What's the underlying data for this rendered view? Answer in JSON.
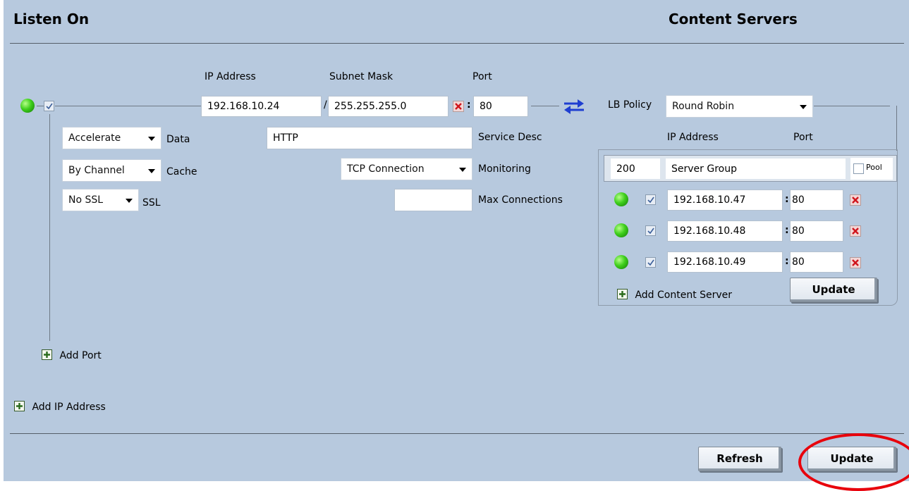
{
  "headers": {
    "listen_on": "Listen On",
    "content_servers": "Content Servers"
  },
  "listen": {
    "col_ip": "IP Address",
    "col_mask": "Subnet Mask",
    "col_port": "Port",
    "status": "online",
    "enabled": true,
    "ip_address": "192.168.10.24",
    "mask_separator": "/",
    "subnet_mask": "255.255.255.0",
    "port_separator": ":",
    "port": "80",
    "data_mode": "Accelerate",
    "data_label": "Data",
    "cache_mode": "By Channel",
    "cache_label": "Cache",
    "ssl_mode": "No SSL",
    "ssl_label": "SSL",
    "service_desc_value": "HTTP",
    "service_desc_label": "Service Desc",
    "monitoring_value": "TCP Connection",
    "monitoring_label": "Monitoring",
    "max_connections_value": "",
    "max_connections_label": "Max Connections",
    "add_port": "Add Port",
    "add_ip": "Add IP Address"
  },
  "content": {
    "lb_policy_label": "LB Policy",
    "lb_policy": "Round Robin",
    "col_ip": "IP Address",
    "col_port": "Port",
    "group_id": "200",
    "group_name": "Server Group",
    "pool_label": "Pool",
    "pool_checked": false,
    "servers": [
      {
        "status": "online",
        "enabled": true,
        "ip": "192.168.10.47",
        "port_separator": ":",
        "port": "80"
      },
      {
        "status": "online",
        "enabled": true,
        "ip": "192.168.10.48",
        "port_separator": ":",
        "port": "80"
      },
      {
        "status": "online",
        "enabled": true,
        "ip": "192.168.10.49",
        "port_separator": ":",
        "port": "80"
      }
    ],
    "add_server": "Add Content Server",
    "update_label": "Update"
  },
  "footer": {
    "refresh_label": "Refresh",
    "update_label": "Update"
  },
  "colors": {
    "panel_bg": "#b7c9de",
    "status_online": "#3fcf1c",
    "link_arrows": "#1f3fd1",
    "highlight_circle": "#e8000b"
  },
  "icons": {
    "status": "green-status-led-icon",
    "remove": "red-x-icon",
    "add": "plus-icon",
    "link": "bidirectional-arrows-icon"
  }
}
